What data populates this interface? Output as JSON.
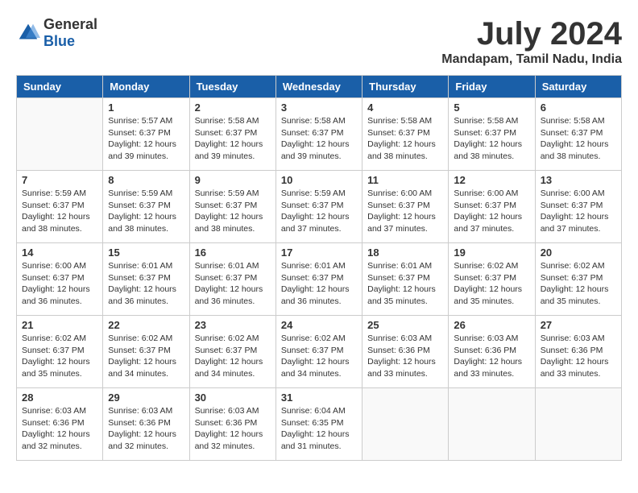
{
  "header": {
    "logo_general": "General",
    "logo_blue": "Blue",
    "month_title": "July 2024",
    "location": "Mandapam, Tamil Nadu, India"
  },
  "weekdays": [
    "Sunday",
    "Monday",
    "Tuesday",
    "Wednesday",
    "Thursday",
    "Friday",
    "Saturday"
  ],
  "weeks": [
    [
      {
        "day": "",
        "content": ""
      },
      {
        "day": "1",
        "content": "Sunrise: 5:57 AM\nSunset: 6:37 PM\nDaylight: 12 hours\nand 39 minutes."
      },
      {
        "day": "2",
        "content": "Sunrise: 5:58 AM\nSunset: 6:37 PM\nDaylight: 12 hours\nand 39 minutes."
      },
      {
        "day": "3",
        "content": "Sunrise: 5:58 AM\nSunset: 6:37 PM\nDaylight: 12 hours\nand 39 minutes."
      },
      {
        "day": "4",
        "content": "Sunrise: 5:58 AM\nSunset: 6:37 PM\nDaylight: 12 hours\nand 38 minutes."
      },
      {
        "day": "5",
        "content": "Sunrise: 5:58 AM\nSunset: 6:37 PM\nDaylight: 12 hours\nand 38 minutes."
      },
      {
        "day": "6",
        "content": "Sunrise: 5:58 AM\nSunset: 6:37 PM\nDaylight: 12 hours\nand 38 minutes."
      }
    ],
    [
      {
        "day": "7",
        "content": "Sunrise: 5:59 AM\nSunset: 6:37 PM\nDaylight: 12 hours\nand 38 minutes."
      },
      {
        "day": "8",
        "content": "Sunrise: 5:59 AM\nSunset: 6:37 PM\nDaylight: 12 hours\nand 38 minutes."
      },
      {
        "day": "9",
        "content": "Sunrise: 5:59 AM\nSunset: 6:37 PM\nDaylight: 12 hours\nand 38 minutes."
      },
      {
        "day": "10",
        "content": "Sunrise: 5:59 AM\nSunset: 6:37 PM\nDaylight: 12 hours\nand 37 minutes."
      },
      {
        "day": "11",
        "content": "Sunrise: 6:00 AM\nSunset: 6:37 PM\nDaylight: 12 hours\nand 37 minutes."
      },
      {
        "day": "12",
        "content": "Sunrise: 6:00 AM\nSunset: 6:37 PM\nDaylight: 12 hours\nand 37 minutes."
      },
      {
        "day": "13",
        "content": "Sunrise: 6:00 AM\nSunset: 6:37 PM\nDaylight: 12 hours\nand 37 minutes."
      }
    ],
    [
      {
        "day": "14",
        "content": "Sunrise: 6:00 AM\nSunset: 6:37 PM\nDaylight: 12 hours\nand 36 minutes."
      },
      {
        "day": "15",
        "content": "Sunrise: 6:01 AM\nSunset: 6:37 PM\nDaylight: 12 hours\nand 36 minutes."
      },
      {
        "day": "16",
        "content": "Sunrise: 6:01 AM\nSunset: 6:37 PM\nDaylight: 12 hours\nand 36 minutes."
      },
      {
        "day": "17",
        "content": "Sunrise: 6:01 AM\nSunset: 6:37 PM\nDaylight: 12 hours\nand 36 minutes."
      },
      {
        "day": "18",
        "content": "Sunrise: 6:01 AM\nSunset: 6:37 PM\nDaylight: 12 hours\nand 35 minutes."
      },
      {
        "day": "19",
        "content": "Sunrise: 6:02 AM\nSunset: 6:37 PM\nDaylight: 12 hours\nand 35 minutes."
      },
      {
        "day": "20",
        "content": "Sunrise: 6:02 AM\nSunset: 6:37 PM\nDaylight: 12 hours\nand 35 minutes."
      }
    ],
    [
      {
        "day": "21",
        "content": "Sunrise: 6:02 AM\nSunset: 6:37 PM\nDaylight: 12 hours\nand 35 minutes."
      },
      {
        "day": "22",
        "content": "Sunrise: 6:02 AM\nSunset: 6:37 PM\nDaylight: 12 hours\nand 34 minutes."
      },
      {
        "day": "23",
        "content": "Sunrise: 6:02 AM\nSunset: 6:37 PM\nDaylight: 12 hours\nand 34 minutes."
      },
      {
        "day": "24",
        "content": "Sunrise: 6:02 AM\nSunset: 6:37 PM\nDaylight: 12 hours\nand 34 minutes."
      },
      {
        "day": "25",
        "content": "Sunrise: 6:03 AM\nSunset: 6:36 PM\nDaylight: 12 hours\nand 33 minutes."
      },
      {
        "day": "26",
        "content": "Sunrise: 6:03 AM\nSunset: 6:36 PM\nDaylight: 12 hours\nand 33 minutes."
      },
      {
        "day": "27",
        "content": "Sunrise: 6:03 AM\nSunset: 6:36 PM\nDaylight: 12 hours\nand 33 minutes."
      }
    ],
    [
      {
        "day": "28",
        "content": "Sunrise: 6:03 AM\nSunset: 6:36 PM\nDaylight: 12 hours\nand 32 minutes."
      },
      {
        "day": "29",
        "content": "Sunrise: 6:03 AM\nSunset: 6:36 PM\nDaylight: 12 hours\nand 32 minutes."
      },
      {
        "day": "30",
        "content": "Sunrise: 6:03 AM\nSunset: 6:36 PM\nDaylight: 12 hours\nand 32 minutes."
      },
      {
        "day": "31",
        "content": "Sunrise: 6:04 AM\nSunset: 6:35 PM\nDaylight: 12 hours\nand 31 minutes."
      },
      {
        "day": "",
        "content": ""
      },
      {
        "day": "",
        "content": ""
      },
      {
        "day": "",
        "content": ""
      }
    ]
  ]
}
